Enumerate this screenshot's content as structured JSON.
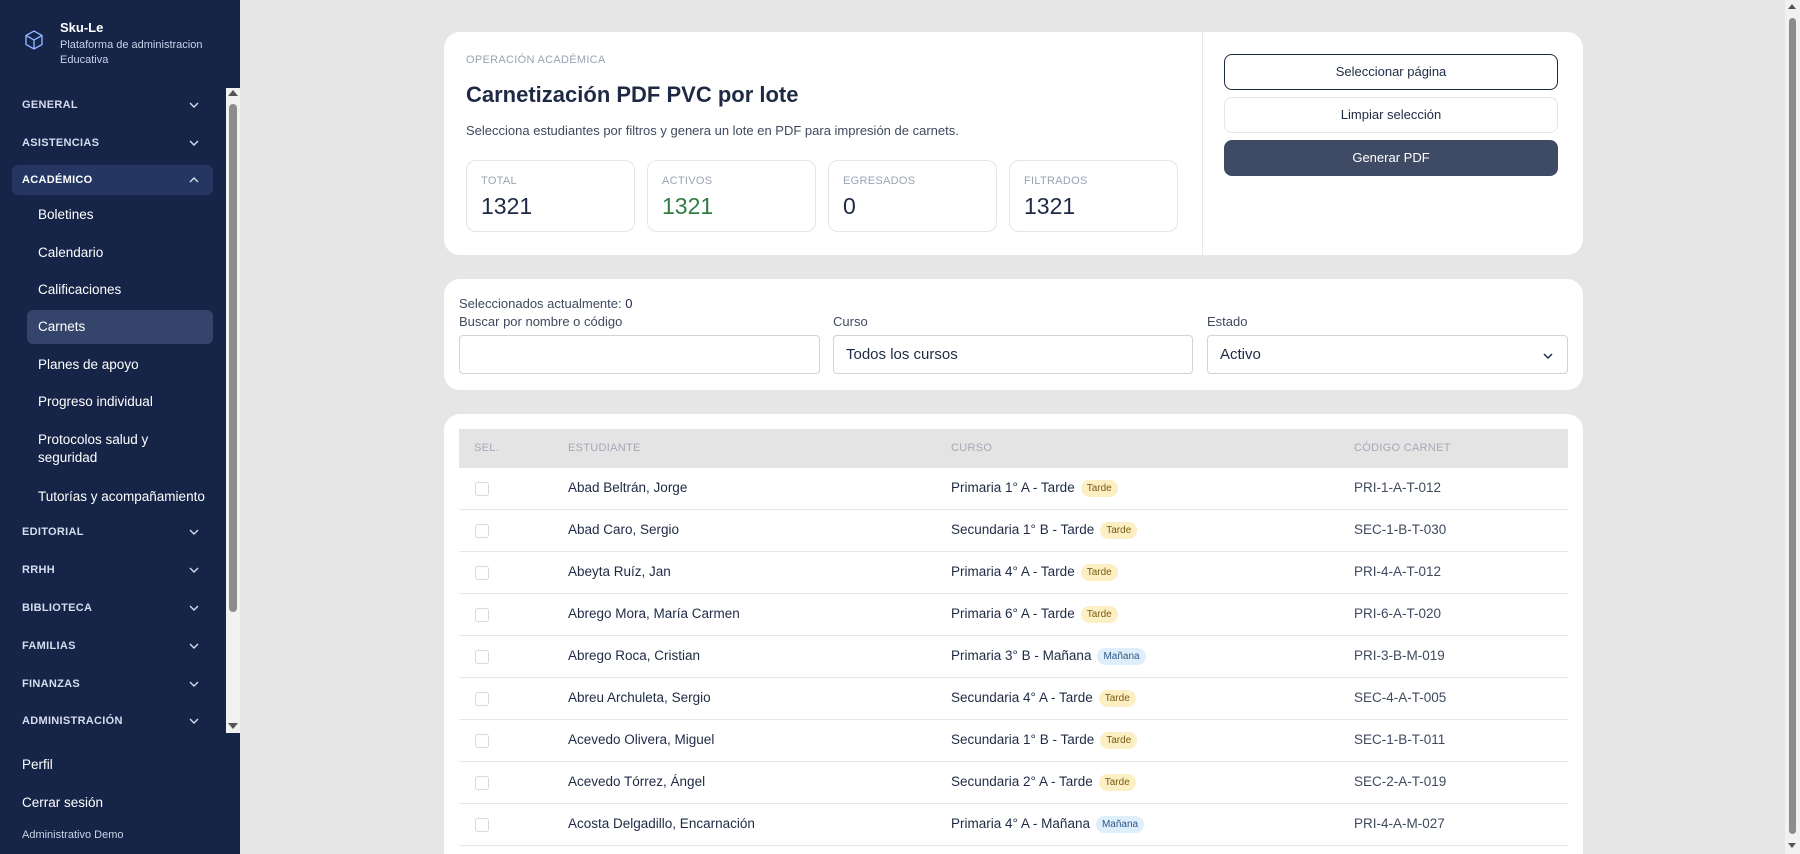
{
  "brand": {
    "name": "Sku-Le",
    "subtitle": "Plataforma de administracion Educativa"
  },
  "sidebar": {
    "groups_top": [
      {
        "label": "GENERAL"
      },
      {
        "label": "ASISTENCIAS"
      },
      {
        "label": "ACADÉMICO"
      }
    ],
    "academic_items": [
      {
        "label": "Boletines"
      },
      {
        "label": "Calendario"
      },
      {
        "label": "Calificaciones"
      },
      {
        "label": "Carnets"
      },
      {
        "label": "Planes de apoyo"
      },
      {
        "label": "Progreso individual"
      },
      {
        "label": "Protocolos salud y seguridad"
      },
      {
        "label": "Tutorías y acompañamiento"
      }
    ],
    "groups_bottom": [
      {
        "label": "EDITORIAL"
      },
      {
        "label": "RRHH"
      },
      {
        "label": "BIBLIOTECA"
      },
      {
        "label": "FAMILIAS"
      },
      {
        "label": "FINANZAS"
      },
      {
        "label": "ADMINISTRACIÓN"
      }
    ],
    "profile": "Perfil",
    "logout": "Cerrar sesión",
    "user": "Administrativo Demo"
  },
  "header": {
    "eyebrow": "OPERACIÓN ACADÉMICA",
    "title": "Carnetización PDF PVC por lote",
    "description": "Selecciona estudiantes por filtros y genera un lote en PDF para impresión de carnets.",
    "stats": [
      {
        "label": "TOTAL",
        "value": "1321"
      },
      {
        "label": "ACTIVOS",
        "value": "1321"
      },
      {
        "label": "EGRESADOS",
        "value": "0"
      },
      {
        "label": "FILTRADOS",
        "value": "1321"
      }
    ],
    "buttons": {
      "select_page": "Seleccionar página",
      "clear_selection": "Limpiar selección",
      "generate_pdf": "Generar PDF"
    }
  },
  "filters": {
    "selected_label": "Seleccionados actualmente:",
    "selected_count": "0",
    "search_label": "Buscar por nombre o código",
    "search_value": "",
    "course_label": "Curso",
    "course_value": "Todos los cursos",
    "status_label": "Estado",
    "status_value": "Activo"
  },
  "table": {
    "headers": {
      "sel": "SEL.",
      "student": "ESTUDIANTE",
      "course": "CURSO",
      "code": "CÓDIGO CARNET"
    },
    "rows": [
      {
        "student": "Abad Beltrán, Jorge",
        "course": "Primaria 1° A - Tarde",
        "shift": "Tarde",
        "code": "PRI-1-A-T-012"
      },
      {
        "student": "Abad Caro, Sergio",
        "course": "Secundaria 1° B - Tarde",
        "shift": "Tarde",
        "code": "SEC-1-B-T-030"
      },
      {
        "student": "Abeyta Ruíz, Jan",
        "course": "Primaria 4° A - Tarde",
        "shift": "Tarde",
        "code": "PRI-4-A-T-012"
      },
      {
        "student": "Abrego Mora, María Carmen",
        "course": "Primaria 6° A - Tarde",
        "shift": "Tarde",
        "code": "PRI-6-A-T-020"
      },
      {
        "student": "Abrego Roca, Cristian",
        "course": "Primaria 3° B - Mañana",
        "shift": "Mañana",
        "code": "PRI-3-B-M-019"
      },
      {
        "student": "Abreu Archuleta, Sergio",
        "course": "Secundaria 4° A - Tarde",
        "shift": "Tarde",
        "code": "SEC-4-A-T-005"
      },
      {
        "student": "Acevedo Olivera, Miguel",
        "course": "Secundaria 1° B - Tarde",
        "shift": "Tarde",
        "code": "SEC-1-B-T-011"
      },
      {
        "student": "Acevedo Tórrez, Ángel",
        "course": "Secundaria 2° A - Tarde",
        "shift": "Tarde",
        "code": "SEC-2-A-T-019"
      },
      {
        "student": "Acosta Delgadillo, Encarnación",
        "course": "Primaria 4° A - Mañana",
        "shift": "Mañana",
        "code": "PRI-4-A-M-027"
      }
    ]
  },
  "colors": {
    "sidebar_bg": "#152447",
    "primary_button": "#3f4a64",
    "active_green": "#2f7d43",
    "tarde_badge": "#fbefc3",
    "manana_badge": "#dfeefb"
  }
}
